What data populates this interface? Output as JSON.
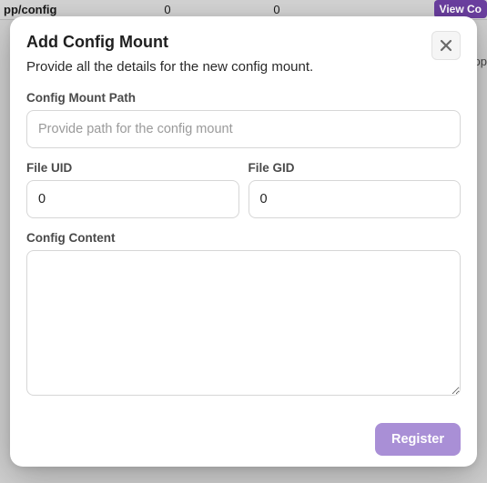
{
  "background": {
    "path_fragment": "pp/config",
    "col1": "0",
    "col2": "0",
    "view_button": "View Co",
    "right_text": "pp"
  },
  "modal": {
    "title": "Add Config Mount",
    "subtitle": "Provide all the details for the new config mount.",
    "fields": {
      "mount_path": {
        "label": "Config Mount Path",
        "placeholder": "Provide path for the config mount",
        "value": ""
      },
      "file_uid": {
        "label": "File UID",
        "value": "0"
      },
      "file_gid": {
        "label": "File GID",
        "value": "0"
      },
      "config_content": {
        "label": "Config Content",
        "value": ""
      }
    },
    "register_label": "Register"
  }
}
